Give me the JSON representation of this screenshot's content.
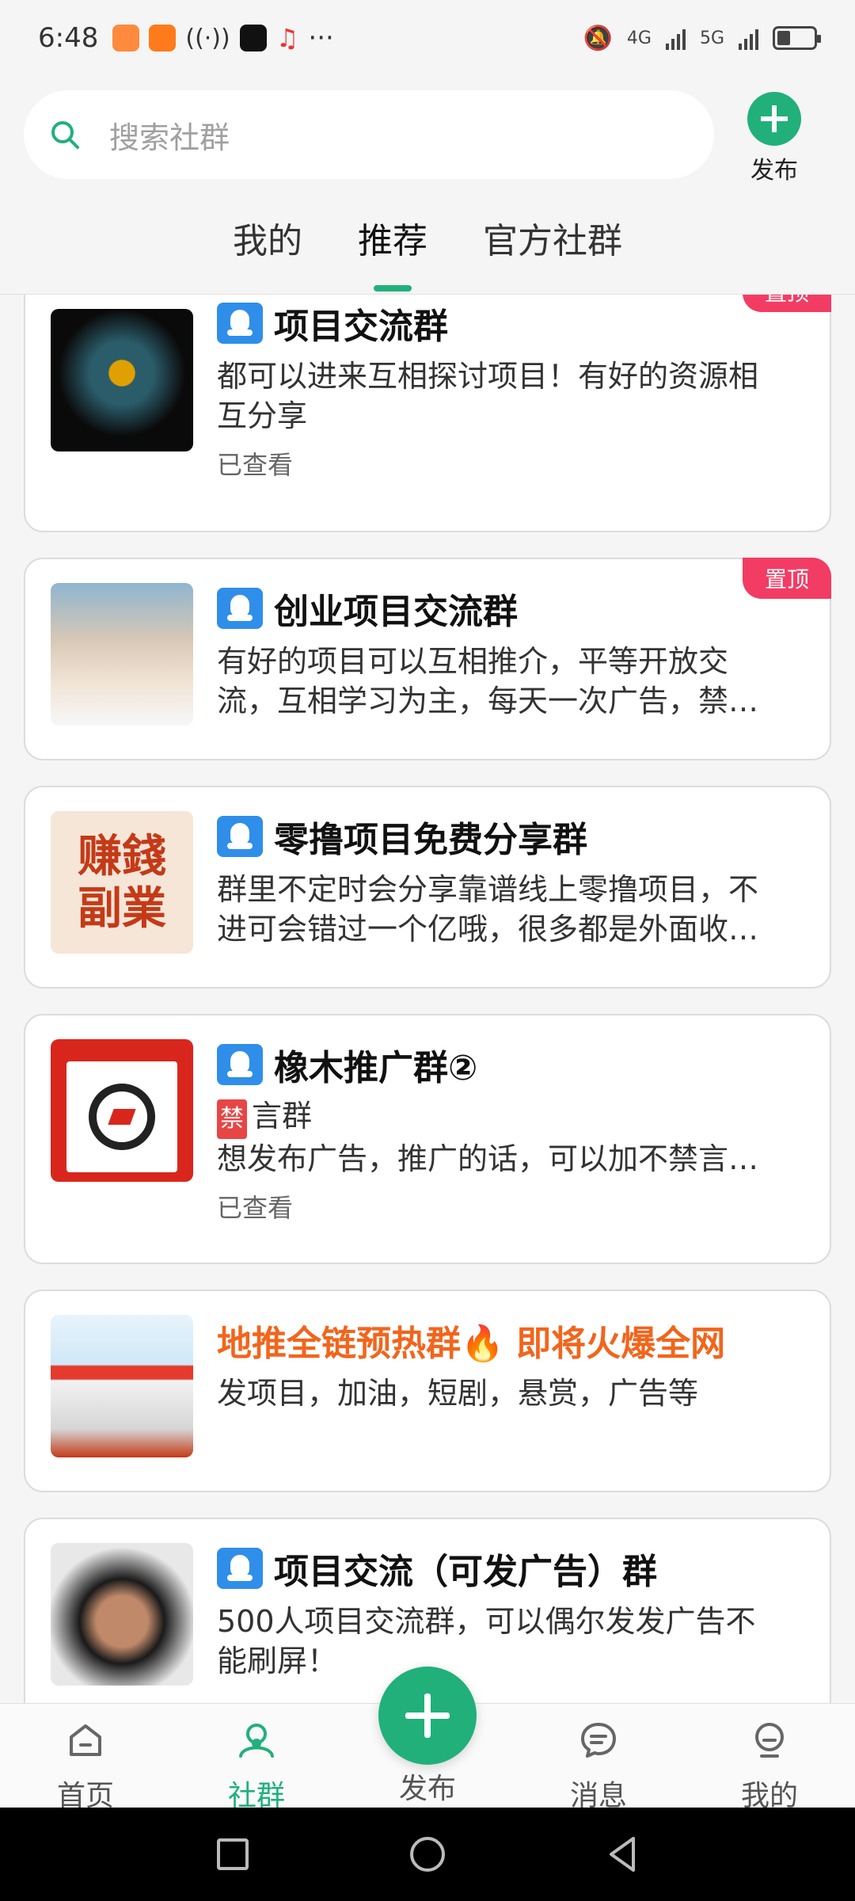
{
  "status_bar": {
    "time": "6:48",
    "more": "···",
    "network_1": "4G",
    "network_2": "5G"
  },
  "search": {
    "placeholder": "搜索社群"
  },
  "publish_top": {
    "label": "发布"
  },
  "tabs": [
    {
      "label": "我的",
      "active": false
    },
    {
      "label": "推荐",
      "active": true
    },
    {
      "label": "官方社群",
      "active": false
    }
  ],
  "groups": [
    {
      "title": "项目交流群",
      "desc": "都可以进来互相探讨项目！有好的资源相互分享",
      "seen": "已查看",
      "pin": "置顶"
    },
    {
      "title": "创业项目交流群",
      "desc": "有好的项目可以互相推介，平等开放交流，互相学习为主，每天一次广告，禁…",
      "pin": "置顶"
    },
    {
      "title": "零撸项目免费分享群",
      "desc": "群里不定时会分享靠谱线上零撸项目，不进可会错过一个亿哦，很多都是外面收…",
      "avatar_text_1": "赚錢",
      "avatar_text_2": "副業"
    },
    {
      "title": "橡木推广群②",
      "ban_tag": "禁",
      "ban_text": "言群",
      "desc": "想发布广告，推广的话，可以加不禁言…",
      "seen": "已查看"
    },
    {
      "title": "地推全链预热群🔥 即将火爆全网",
      "desc": "发项目，加油，短剧，悬赏，广告等"
    },
    {
      "title": "项目交流（可发广告）群",
      "desc": "500人项目交流群，可以偶尔发发广告不能刷屏！"
    }
  ],
  "bottom_nav": [
    {
      "label": "首页",
      "icon": "home-icon",
      "active": false
    },
    {
      "label": "社群",
      "icon": "community-icon",
      "active": true
    },
    {
      "label": "发布",
      "icon": "plus-icon",
      "active": false
    },
    {
      "label": "消息",
      "icon": "message-icon",
      "active": false
    },
    {
      "label": "我的",
      "icon": "profile-icon",
      "active": false
    }
  ],
  "colors": {
    "accent": "#21b07a",
    "pin": "#f23c64",
    "qq_badge": "#2f8eea",
    "highlight_title": "#f2651c"
  }
}
